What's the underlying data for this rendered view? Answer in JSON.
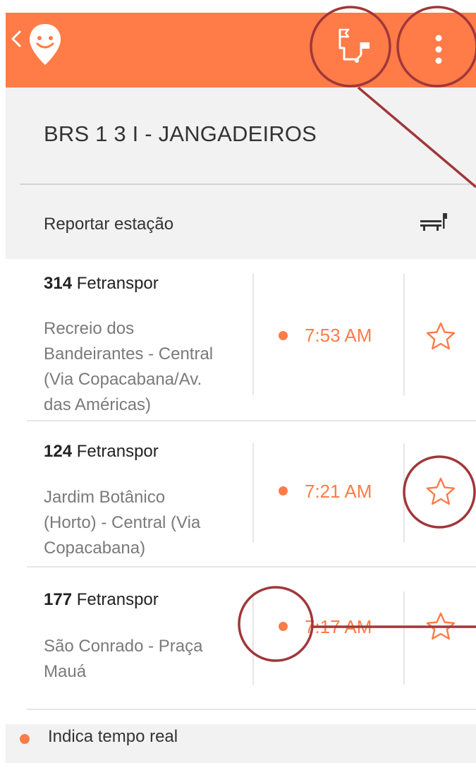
{
  "station": {
    "title": "BRS 1 3 I - JANGADEIROS",
    "report_label": "Reportar estação"
  },
  "toolbar": {
    "back_icon": "chevron-left-icon",
    "logo_icon": "smiley-pin-icon",
    "route_icon": "route-flags-icon",
    "more_icon": "more-vertical-icon"
  },
  "lines": [
    {
      "number": "314",
      "operator": "Fetranspor",
      "destination_lines": [
        "Recreio dos",
        "Bandeirantes - Central",
        "(Via Copacabana/Av.",
        "das Américas)"
      ],
      "time": "7:53 AM",
      "realtime": true
    },
    {
      "number": "124",
      "operator": "Fetranspor",
      "destination_lines": [
        "Jardim Botânico",
        "(Horto) - Central (Via",
        "Copacabana)"
      ],
      "time": "7:21 AM",
      "realtime": true
    },
    {
      "number": "177",
      "operator": "Fetranspor",
      "destination_lines": [
        "São Conrado - Praça",
        "Mauá"
      ],
      "time": "7:17 AM",
      "realtime": true
    }
  ],
  "footer": {
    "legend": "Indica tempo real"
  },
  "colors": {
    "accent": "#ff7b48",
    "annotation": "#a0373a"
  }
}
